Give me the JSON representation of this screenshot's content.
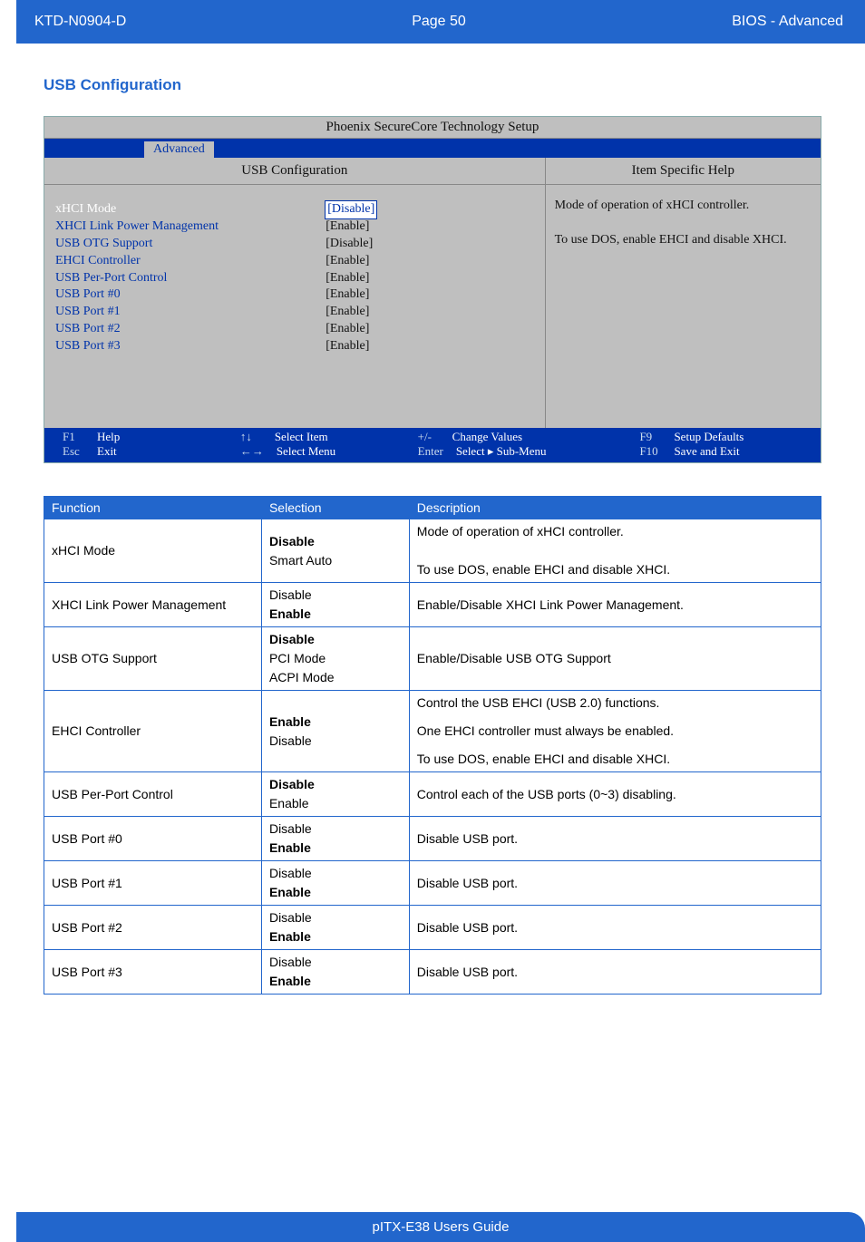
{
  "header": {
    "doc_id": "KTD-N0904-D",
    "page_label": "Page 50",
    "section": "BIOS  - Advanced"
  },
  "section_title": "USB Configuration",
  "bios": {
    "title": "Phoenix SecureCore Technology Setup",
    "tab": "Advanced",
    "panel_title": "USB Configuration",
    "help_title": "Item Specific Help",
    "help_text": "Mode of operation of xHCI controller.\n\nTo use DOS, enable EHCI and disable XHCI.",
    "settings": [
      {
        "label": "xHCI Mode",
        "value": "[Disable]",
        "selected": true
      },
      {
        "label": "XHCI Link Power Management",
        "value": "[Enable]"
      },
      {
        "label": "",
        "value": ""
      },
      {
        "label": "USB OTG Support",
        "value": "[Disable]"
      },
      {
        "label": "",
        "value": ""
      },
      {
        "label": "EHCI Controller",
        "value": "[Enable]"
      },
      {
        "label": "USB Per-Port Control",
        "value": "[Enable]"
      },
      {
        "label": "USB Port #0",
        "value": "[Enable]"
      },
      {
        "label": "USB Port #1",
        "value": "[Enable]"
      },
      {
        "label": "USB Port #2",
        "value": "[Enable]"
      },
      {
        "label": "USB Port #3",
        "value": "[Enable]"
      }
    ],
    "footer": [
      {
        "key": "F1",
        "action": "Help"
      },
      {
        "key": "↑↓",
        "action": "Select Item"
      },
      {
        "key": "+/-",
        "action": "Change Values"
      },
      {
        "key": "F9",
        "action": "Setup Defaults"
      },
      {
        "key": "Esc",
        "action": "Exit"
      },
      {
        "key": "←→",
        "action": "Select Menu"
      },
      {
        "key": "Enter",
        "action": "Select ▸ Sub-Menu"
      },
      {
        "key": "F10",
        "action": "Save and Exit"
      }
    ]
  },
  "table": {
    "headers": [
      "Function",
      "Selection",
      "Description"
    ],
    "rows": [
      {
        "function": "xHCI Mode",
        "selection_html": "<b>Disable</b><br>Smart Auto",
        "description_html": "Mode of operation of xHCI controller.<br><br>To use DOS, enable EHCI and disable XHCI."
      },
      {
        "function": "XHCI Link Power Management",
        "selection_html": "Disable<br><b>Enable</b>",
        "description_html": "Enable/Disable XHCI Link Power Management."
      },
      {
        "function": "USB OTG Support",
        "selection_html": "<b>Disable</b><br>PCI Mode<br>ACPI Mode",
        "description_html": "Enable/Disable USB OTG Support"
      },
      {
        "function": "EHCI Controller",
        "selection_html": "<b>Enable</b><br>Disable",
        "description_html": "<p>Control the USB EHCI (USB 2.0) functions.</p><p>One EHCI controller must always be enabled.</p><p>To use DOS, enable EHCI and disable XHCI.</p>"
      },
      {
        "function": "USB Per-Port Control",
        "selection_html": "<b>Disable</b><br>Enable",
        "description_html": "Control each of the USB ports (0~3) disabling."
      },
      {
        "function": "USB Port #0",
        "selection_html": "Disable<br><b>Enable</b>",
        "description_html": "Disable USB port."
      },
      {
        "function": "USB Port #1",
        "selection_html": "Disable<br><b>Enable</b>",
        "description_html": "Disable USB port."
      },
      {
        "function": "USB Port #2",
        "selection_html": "Disable<br><b>Enable</b>",
        "description_html": "Disable USB port."
      },
      {
        "function": "USB Port #3",
        "selection_html": "Disable<br><b>Enable</b>",
        "description_html": "Disable USB port."
      }
    ]
  },
  "footer": {
    "text": "pITX-E38 Users Guide"
  }
}
